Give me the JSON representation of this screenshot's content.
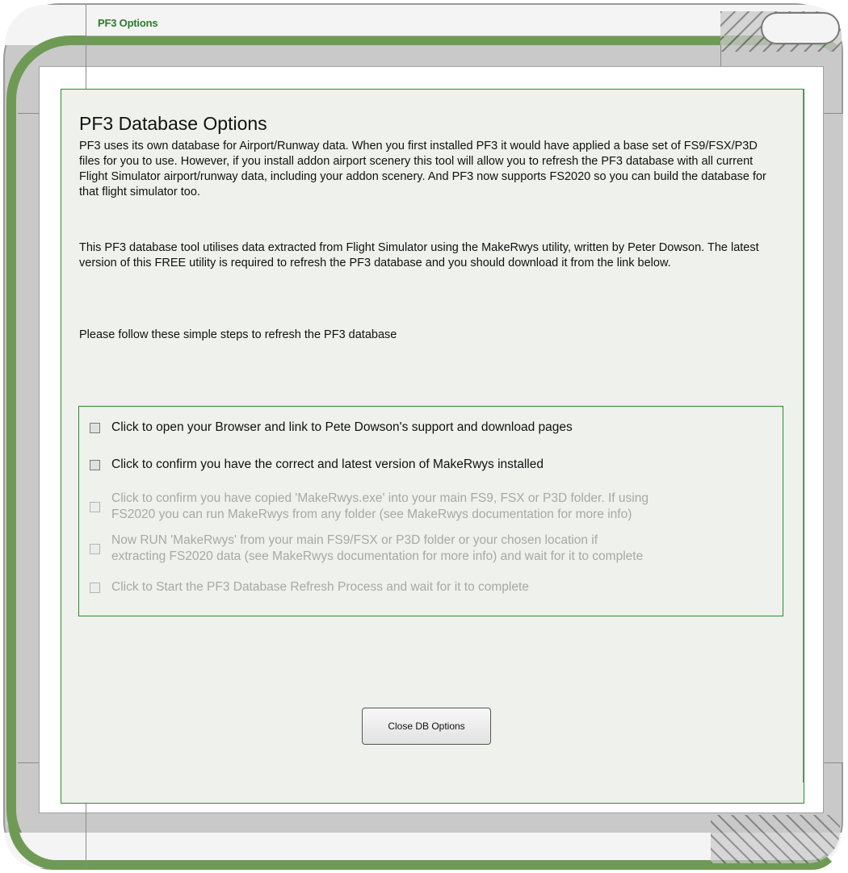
{
  "window": {
    "title": "PF3 Options"
  },
  "main": {
    "heading": "PF3 Database Options",
    "paragraphs": [
      "PF3 uses its own database for Airport/Runway data. When you first installed PF3 it would have applied a base set of FS9/FSX/P3D files for you to use. However, if you install addon airport scenery this tool will allow you to refresh the PF3 database with all current Flight Simulator airport/runway data, including your addon scenery. And PF3 now supports FS2020 so you can build the database for that flight simulator too.",
      "This PF3 database tool utilises data extracted from Flight Simulator using the MakeRwys utility, written by Peter Dowson. The latest version of this FREE utility is required to refresh the PF3 database and you should download it from the link below.",
      "Please follow these simple steps to refresh the PF3 database"
    ],
    "steps": [
      {
        "label": "Click to open your Browser and link to Pete Dowson's support and download pages",
        "enabled": true,
        "checked": false
      },
      {
        "label": "Click to confirm you have the correct and  latest version of MakeRwys installed",
        "enabled": true,
        "checked": false
      },
      {
        "label": "Click to confirm you have copied 'MakeRwys.exe' into your main FS9, FSX or P3D folder. If using\nFS2020 you can run MakeRwys from any folder (see MakeRwys documentation for more info)",
        "enabled": false,
        "checked": false
      },
      {
        "label": "Now RUN 'MakeRwys' from your main FS9/FSX or P3D folder or your chosen location if\nextracting FS2020 data (see MakeRwys documentation for more info) and wait for it to complete",
        "enabled": false,
        "checked": false
      },
      {
        "label": "Click to Start the PF3 Database Refresh Process and wait for it to complete",
        "enabled": false,
        "checked": false
      }
    ],
    "close_button_label": "Close DB Options"
  }
}
